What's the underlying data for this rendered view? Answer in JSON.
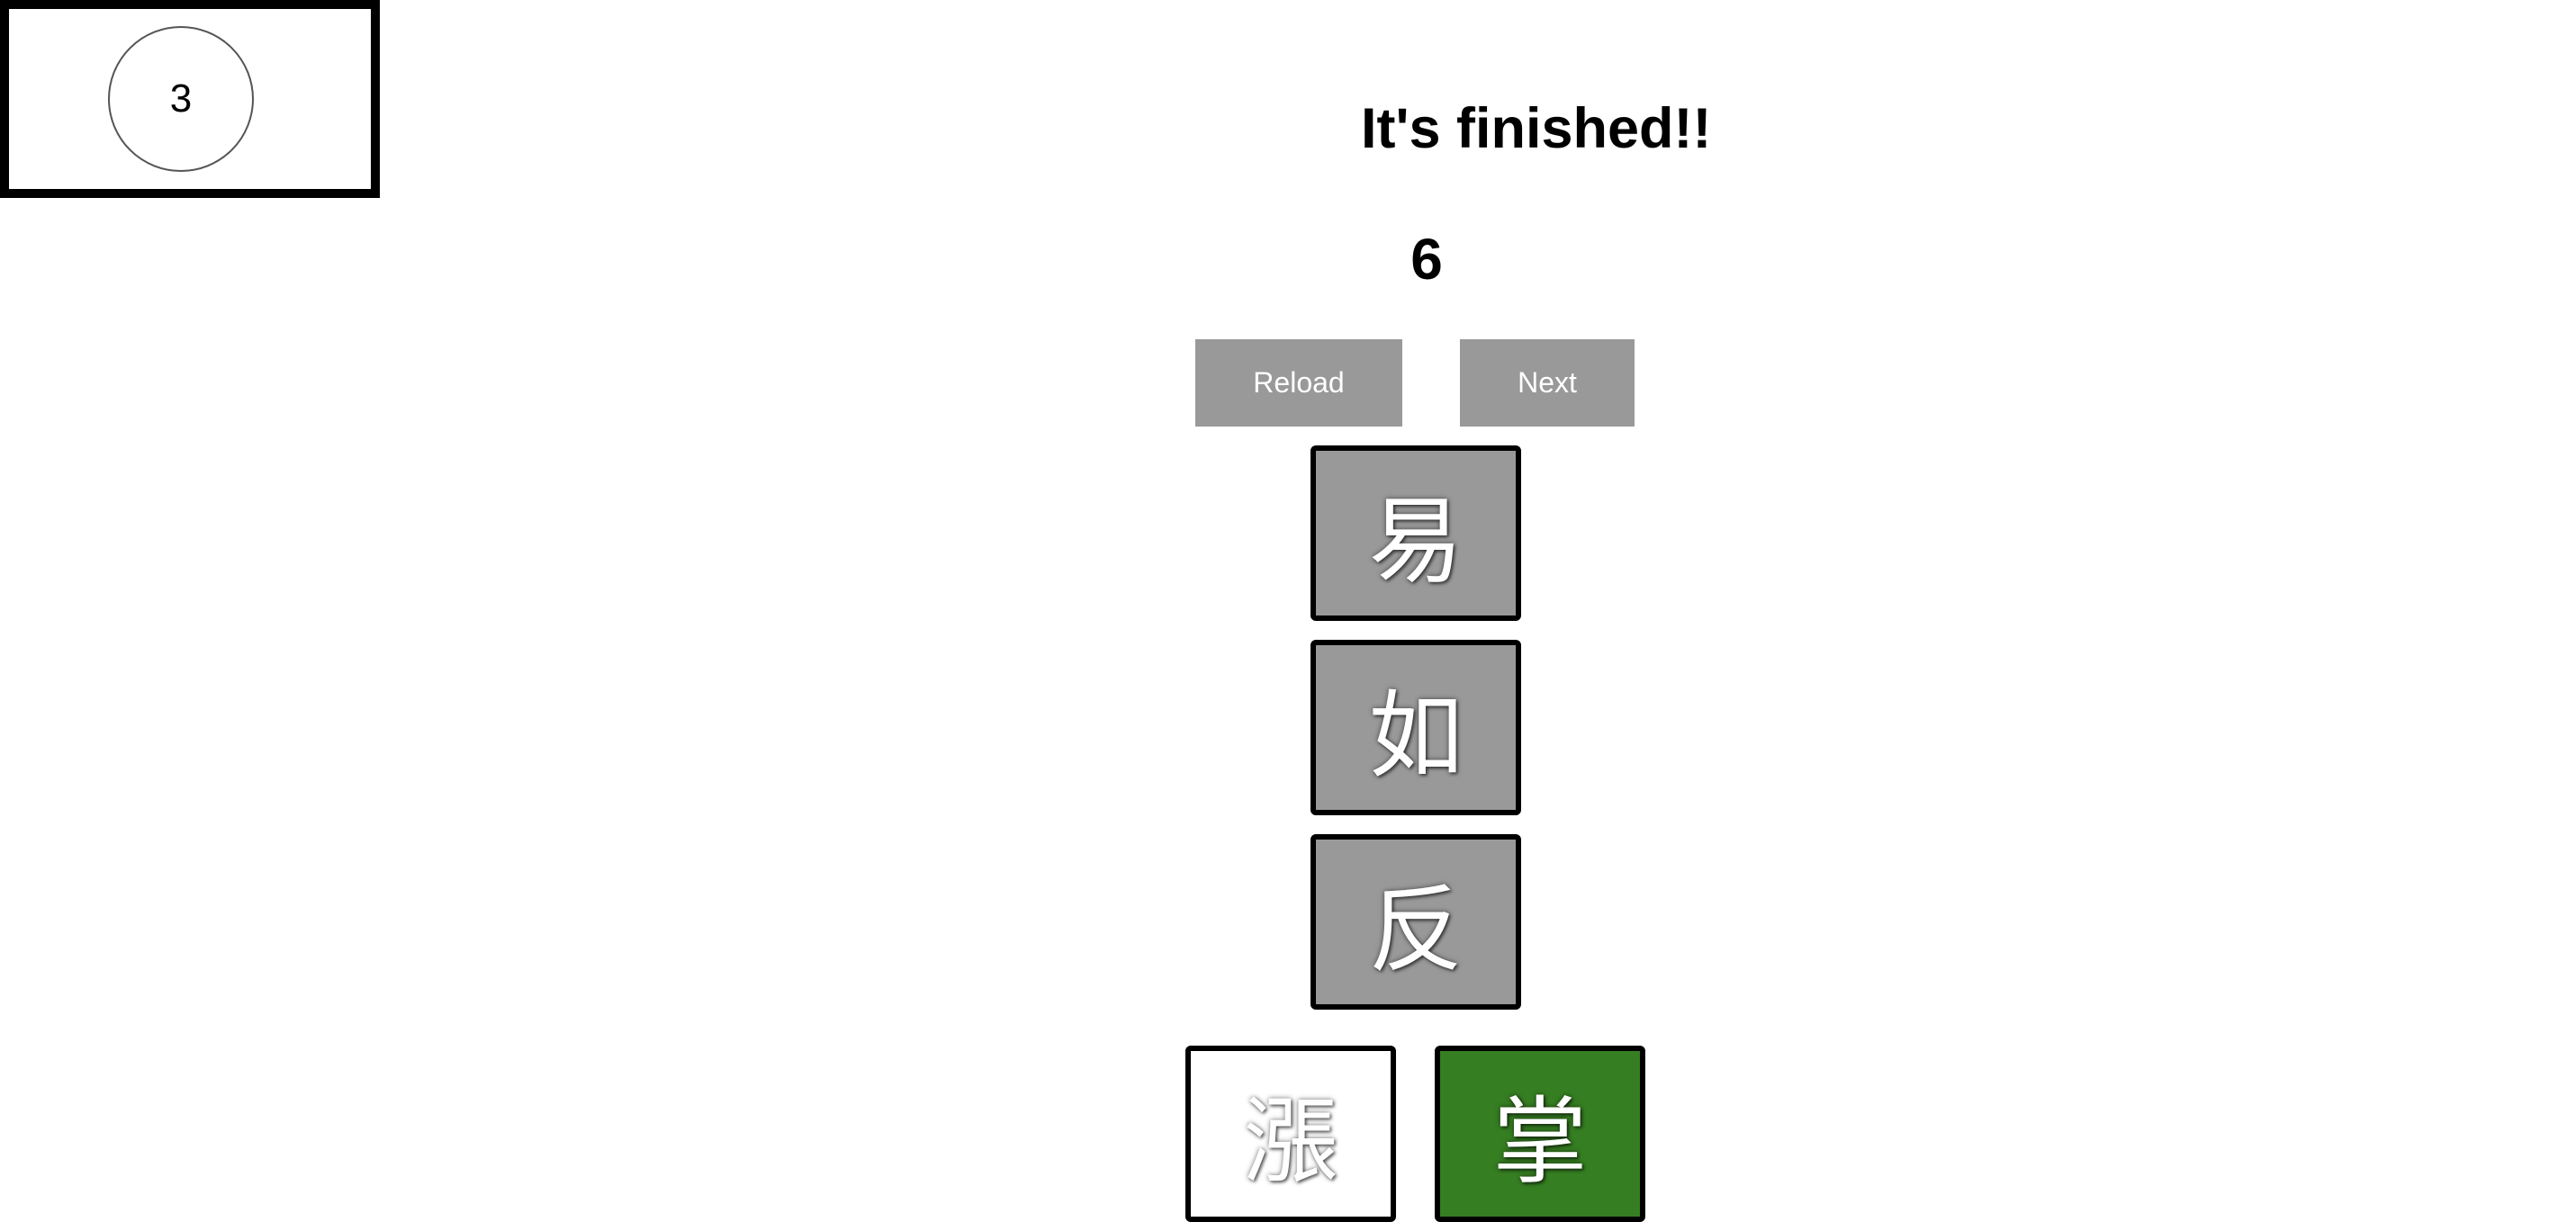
{
  "timer": {
    "value": "3"
  },
  "header": {
    "title": "It's finished!!",
    "score": "6"
  },
  "buttons": {
    "reload_label": "Reload",
    "next_label": "Next"
  },
  "tiles": {
    "stack": [
      "易",
      "如",
      "反"
    ],
    "choices": [
      {
        "char": "漲",
        "color": "#ffffff"
      },
      {
        "char": "掌",
        "color": "#367e22"
      }
    ]
  },
  "colors": {
    "button_bg": "#999999",
    "tile_bg": "#999999",
    "correct_green": "#367e22"
  }
}
